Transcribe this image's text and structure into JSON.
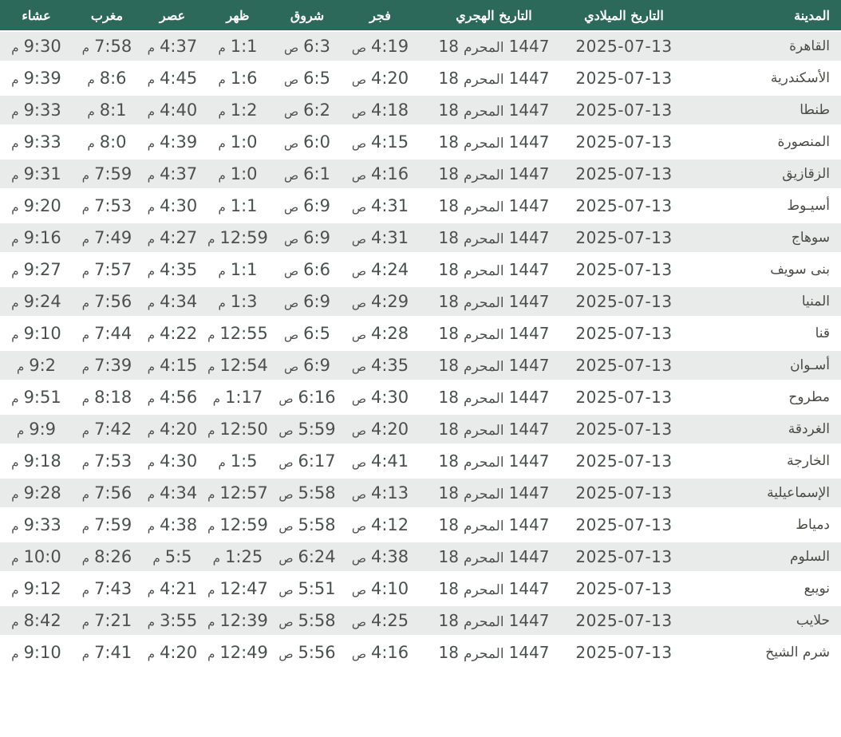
{
  "colors": {
    "header_bg": "#2d695b",
    "header_text": "#ffffff",
    "row_alt_bg": "#e8ebe9",
    "row_bg": "#ffffff",
    "time_text": "#4b504e",
    "city_text": "#4a4b47"
  },
  "table": {
    "columns": [
      {
        "key": "city",
        "label": "المدينة"
      },
      {
        "key": "gregorian",
        "label": "التاريخ الميلادي"
      },
      {
        "key": "hijri",
        "label": "التاريخ الهجري"
      },
      {
        "key": "fajr",
        "label": "فجر"
      },
      {
        "key": "sunrise",
        "label": "شروق"
      },
      {
        "key": "dhuhr",
        "label": "ظهر"
      },
      {
        "key": "asr",
        "label": "عصر"
      },
      {
        "key": "maghrib",
        "label": "مغرب"
      },
      {
        "key": "isha",
        "label": "عشاء"
      }
    ],
    "rows": [
      {
        "city": "القاهرة",
        "gregorian": "2025-07-13",
        "hijri_day": "18",
        "hijri_month": "المحرم",
        "hijri_year": "1447",
        "fajr": "4:19 ص",
        "sunrise": "6:3 ص",
        "dhuhr": "1:1 م",
        "asr": "4:37 م",
        "maghrib": "7:58 م",
        "isha": "9:30 م"
      },
      {
        "city": "الأسكندرية",
        "gregorian": "2025-07-13",
        "hijri_day": "18",
        "hijri_month": "المحرم",
        "hijri_year": "1447",
        "fajr": "4:20 ص",
        "sunrise": "6:5 ص",
        "dhuhr": "1:6 م",
        "asr": "4:45 م",
        "maghrib": "8:6 م",
        "isha": "9:39 م"
      },
      {
        "city": "طنطا",
        "gregorian": "2025-07-13",
        "hijri_day": "18",
        "hijri_month": "المحرم",
        "hijri_year": "1447",
        "fajr": "4:18 ص",
        "sunrise": "6:2 ص",
        "dhuhr": "1:2 م",
        "asr": "4:40 م",
        "maghrib": "8:1 م",
        "isha": "9:33 م"
      },
      {
        "city": "المنصورة",
        "gregorian": "2025-07-13",
        "hijri_day": "18",
        "hijri_month": "المحرم",
        "hijri_year": "1447",
        "fajr": "4:15 ص",
        "sunrise": "6:0 ص",
        "dhuhr": "1:0 م",
        "asr": "4:39 م",
        "maghrib": "8:0 م",
        "isha": "9:33 م"
      },
      {
        "city": "الزقازيق",
        "gregorian": "2025-07-13",
        "hijri_day": "18",
        "hijri_month": "المحرم",
        "hijri_year": "1447",
        "fajr": "4:16 ص",
        "sunrise": "6:1 ص",
        "dhuhr": "1:0 م",
        "asr": "4:37 م",
        "maghrib": "7:59 م",
        "isha": "9:31 م"
      },
      {
        "city": "أسيـوط",
        "gregorian": "2025-07-13",
        "hijri_day": "18",
        "hijri_month": "المحرم",
        "hijri_year": "1447",
        "fajr": "4:31 ص",
        "sunrise": "6:9 ص",
        "dhuhr": "1:1 م",
        "asr": "4:30 م",
        "maghrib": "7:53 م",
        "isha": "9:20 م"
      },
      {
        "city": "سوهاج",
        "gregorian": "2025-07-13",
        "hijri_day": "18",
        "hijri_month": "المحرم",
        "hijri_year": "1447",
        "fajr": "4:31 ص",
        "sunrise": "6:9 ص",
        "dhuhr": "12:59 م",
        "asr": "4:27 م",
        "maghrib": "7:49 م",
        "isha": "9:16 م"
      },
      {
        "city": "بنى سويف",
        "gregorian": "2025-07-13",
        "hijri_day": "18",
        "hijri_month": "المحرم",
        "hijri_year": "1447",
        "fajr": "4:24 ص",
        "sunrise": "6:6 ص",
        "dhuhr": "1:1 م",
        "asr": "4:35 م",
        "maghrib": "7:57 م",
        "isha": "9:27 م"
      },
      {
        "city": "المنيا",
        "gregorian": "2025-07-13",
        "hijri_day": "18",
        "hijri_month": "المحرم",
        "hijri_year": "1447",
        "fajr": "4:29 ص",
        "sunrise": "6:9 ص",
        "dhuhr": "1:3 م",
        "asr": "4:34 م",
        "maghrib": "7:56 م",
        "isha": "9:24 م"
      },
      {
        "city": "قنا",
        "gregorian": "2025-07-13",
        "hijri_day": "18",
        "hijri_month": "المحرم",
        "hijri_year": "1447",
        "fajr": "4:28 ص",
        "sunrise": "6:5 ص",
        "dhuhr": "12:55 م",
        "asr": "4:22 م",
        "maghrib": "7:44 م",
        "isha": "9:10 م"
      },
      {
        "city": "أسـوان",
        "gregorian": "2025-07-13",
        "hijri_day": "18",
        "hijri_month": "المحرم",
        "hijri_year": "1447",
        "fajr": "4:35 ص",
        "sunrise": "6:9 ص",
        "dhuhr": "12:54 م",
        "asr": "4:15 م",
        "maghrib": "7:39 م",
        "isha": "9:2 م"
      },
      {
        "city": "مطروح",
        "gregorian": "2025-07-13",
        "hijri_day": "18",
        "hijri_month": "المحرم",
        "hijri_year": "1447",
        "fajr": "4:30 ص",
        "sunrise": "6:16 ص",
        "dhuhr": "1:17 م",
        "asr": "4:56 م",
        "maghrib": "8:18 م",
        "isha": "9:51 م"
      },
      {
        "city": "الغردقة",
        "gregorian": "2025-07-13",
        "hijri_day": "18",
        "hijri_month": "المحرم",
        "hijri_year": "1447",
        "fajr": "4:20 ص",
        "sunrise": "5:59 ص",
        "dhuhr": "12:50 م",
        "asr": "4:20 م",
        "maghrib": "7:42 م",
        "isha": "9:9 م"
      },
      {
        "city": "الخارجة",
        "gregorian": "2025-07-13",
        "hijri_day": "18",
        "hijri_month": "المحرم",
        "hijri_year": "1447",
        "fajr": "4:41 ص",
        "sunrise": "6:17 ص",
        "dhuhr": "1:5 م",
        "asr": "4:30 م",
        "maghrib": "7:53 م",
        "isha": "9:18 م"
      },
      {
        "city": "الإسماعيلية",
        "gregorian": "2025-07-13",
        "hijri_day": "18",
        "hijri_month": "المحرم",
        "hijri_year": "1447",
        "fajr": "4:13 ص",
        "sunrise": "5:58 ص",
        "dhuhr": "12:57 م",
        "asr": "4:34 م",
        "maghrib": "7:56 م",
        "isha": "9:28 م"
      },
      {
        "city": "دمياط",
        "gregorian": "2025-07-13",
        "hijri_day": "18",
        "hijri_month": "المحرم",
        "hijri_year": "1447",
        "fajr": "4:12 ص",
        "sunrise": "5:58 ص",
        "dhuhr": "12:59 م",
        "asr": "4:38 م",
        "maghrib": "7:59 م",
        "isha": "9:33 م"
      },
      {
        "city": "السلوم",
        "gregorian": "2025-07-13",
        "hijri_day": "18",
        "hijri_month": "المحرم",
        "hijri_year": "1447",
        "fajr": "4:38 ص",
        "sunrise": "6:24 ص",
        "dhuhr": "1:25 م",
        "asr": "5:5 م",
        "maghrib": "8:26 م",
        "isha": "10:0 م"
      },
      {
        "city": "نويبع",
        "gregorian": "2025-07-13",
        "hijri_day": "18",
        "hijri_month": "المحرم",
        "hijri_year": "1447",
        "fajr": "4:10 ص",
        "sunrise": "5:51 ص",
        "dhuhr": "12:47 م",
        "asr": "4:21 م",
        "maghrib": "7:43 م",
        "isha": "9:12 م"
      },
      {
        "city": "حلايب",
        "gregorian": "2025-07-13",
        "hijri_day": "18",
        "hijri_month": "المحرم",
        "hijri_year": "1447",
        "fajr": "4:25 ص",
        "sunrise": "5:58 ص",
        "dhuhr": "12:39 م",
        "asr": "3:55 م",
        "maghrib": "7:21 م",
        "isha": "8:42 م"
      },
      {
        "city": "شرم الشيخ",
        "gregorian": "2025-07-13",
        "hijri_day": "18",
        "hijri_month": "المحرم",
        "hijri_year": "1447",
        "fajr": "4:16 ص",
        "sunrise": "5:56 ص",
        "dhuhr": "12:49 م",
        "asr": "4:20 م",
        "maghrib": "7:41 م",
        "isha": "9:10 م"
      }
    ]
  }
}
